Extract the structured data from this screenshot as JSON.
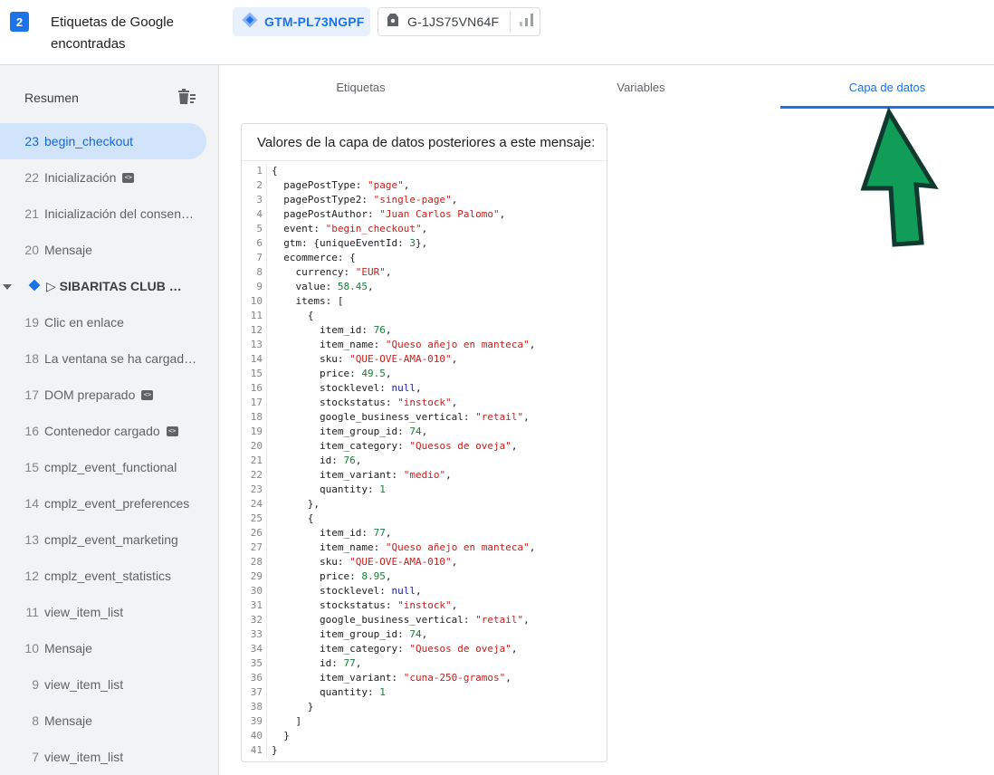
{
  "header": {
    "count_badge": "2",
    "title": "Etiquetas de Google encontradas",
    "gtm_container": "GTM-PL73NGPF",
    "ga_property": "G-1JS75VN64F",
    "icons": {
      "gtm": "gtm-diamond-icon",
      "ga": "ga-tag-icon",
      "analytics": "bar-chart-icon"
    }
  },
  "sidebar": {
    "title": "Resumen",
    "clear_icon": "clear-list-icon",
    "items": [
      {
        "num": "23",
        "label": "begin_checkout",
        "selected": true,
        "code_chip": false
      },
      {
        "num": "22",
        "label": "Inicialización",
        "selected": false,
        "code_chip": true
      },
      {
        "num": "21",
        "label": "Inicialización del consen…",
        "selected": false,
        "code_chip": false
      },
      {
        "num": "20",
        "label": "Mensaje",
        "selected": false,
        "code_chip": false
      },
      {
        "group": true,
        "label": "SIBARITAS CLUB",
        "prefix": "▷",
        "suffix": "◁ T…"
      },
      {
        "num": "19",
        "label": "Clic en enlace",
        "selected": false,
        "code_chip": false
      },
      {
        "num": "18",
        "label": "La ventana se ha cargad…",
        "selected": false,
        "code_chip": false
      },
      {
        "num": "17",
        "label": "DOM preparado",
        "selected": false,
        "code_chip": true
      },
      {
        "num": "16",
        "label": "Contenedor cargado",
        "selected": false,
        "code_chip": true
      },
      {
        "num": "15",
        "label": "cmplz_event_functional",
        "selected": false,
        "code_chip": false
      },
      {
        "num": "14",
        "label": "cmplz_event_preferences",
        "selected": false,
        "code_chip": false
      },
      {
        "num": "13",
        "label": "cmplz_event_marketing",
        "selected": false,
        "code_chip": false
      },
      {
        "num": "12",
        "label": "cmplz_event_statistics",
        "selected": false,
        "code_chip": false
      },
      {
        "num": "11",
        "label": "view_item_list",
        "selected": false,
        "code_chip": false
      },
      {
        "num": "10",
        "label": "Mensaje",
        "selected": false,
        "code_chip": false
      },
      {
        "num": "9",
        "label": "view_item_list",
        "selected": false,
        "code_chip": false
      },
      {
        "num": "8",
        "label": "Mensaje",
        "selected": false,
        "code_chip": false
      },
      {
        "num": "7",
        "label": "view_item_list",
        "selected": false,
        "code_chip": false
      }
    ]
  },
  "tabs": [
    {
      "label": "Etiquetas",
      "active": false
    },
    {
      "label": "Variables",
      "active": false
    },
    {
      "label": "Capa de datos",
      "active": true
    }
  ],
  "datalayer_card": {
    "title": "Valores de la capa de datos posteriores a este mensaje:",
    "lines": [
      [
        [
          "p",
          "{"
        ]
      ],
      [
        [
          "k",
          "  pagePostType: "
        ],
        [
          "s",
          "\"page\""
        ],
        [
          "p",
          ","
        ]
      ],
      [
        [
          "k",
          "  pagePostType2: "
        ],
        [
          "s",
          "\"single-page\""
        ],
        [
          "p",
          ","
        ]
      ],
      [
        [
          "k",
          "  pagePostAuthor: "
        ],
        [
          "s",
          "\"Juan Carlos Palomo\""
        ],
        [
          "p",
          ","
        ]
      ],
      [
        [
          "k",
          "  event: "
        ],
        [
          "s",
          "\"begin_checkout\""
        ],
        [
          "p",
          ","
        ]
      ],
      [
        [
          "k",
          "  gtm: {uniqueEventId: "
        ],
        [
          "n",
          "3"
        ],
        [
          "p",
          "},"
        ]
      ],
      [
        [
          "k",
          "  ecommerce: {"
        ]
      ],
      [
        [
          "k",
          "    currency: "
        ],
        [
          "s",
          "\"EUR\""
        ],
        [
          "p",
          ","
        ]
      ],
      [
        [
          "k",
          "    value: "
        ],
        [
          "n",
          "58.45"
        ],
        [
          "p",
          ","
        ]
      ],
      [
        [
          "k",
          "    items: ["
        ]
      ],
      [
        [
          "p",
          "      {"
        ]
      ],
      [
        [
          "k",
          "        item_id: "
        ],
        [
          "n",
          "76"
        ],
        [
          "p",
          ","
        ]
      ],
      [
        [
          "k",
          "        item_name: "
        ],
        [
          "s",
          "\"Queso añejo en manteca\""
        ],
        [
          "p",
          ","
        ]
      ],
      [
        [
          "k",
          "        sku: "
        ],
        [
          "s",
          "\"QUE-OVE-AMA-010\""
        ],
        [
          "p",
          ","
        ]
      ],
      [
        [
          "k",
          "        price: "
        ],
        [
          "n",
          "49.5"
        ],
        [
          "p",
          ","
        ]
      ],
      [
        [
          "k",
          "        stocklevel: "
        ],
        [
          "w",
          "null"
        ],
        [
          "p",
          ","
        ]
      ],
      [
        [
          "k",
          "        stockstatus: "
        ],
        [
          "s",
          "\"instock\""
        ],
        [
          "p",
          ","
        ]
      ],
      [
        [
          "k",
          "        google_business_vertical: "
        ],
        [
          "s",
          "\"retail\""
        ],
        [
          "p",
          ","
        ]
      ],
      [
        [
          "k",
          "        item_group_id: "
        ],
        [
          "n",
          "74"
        ],
        [
          "p",
          ","
        ]
      ],
      [
        [
          "k",
          "        item_category: "
        ],
        [
          "s",
          "\"Quesos de oveja\""
        ],
        [
          "p",
          ","
        ]
      ],
      [
        [
          "k",
          "        id: "
        ],
        [
          "n",
          "76"
        ],
        [
          "p",
          ","
        ]
      ],
      [
        [
          "k",
          "        item_variant: "
        ],
        [
          "s",
          "\"medio\""
        ],
        [
          "p",
          ","
        ]
      ],
      [
        [
          "k",
          "        quantity: "
        ],
        [
          "n",
          "1"
        ]
      ],
      [
        [
          "p",
          "      },"
        ]
      ],
      [
        [
          "p",
          "      {"
        ]
      ],
      [
        [
          "k",
          "        item_id: "
        ],
        [
          "n",
          "77"
        ],
        [
          "p",
          ","
        ]
      ],
      [
        [
          "k",
          "        item_name: "
        ],
        [
          "s",
          "\"Queso añejo en manteca\""
        ],
        [
          "p",
          ","
        ]
      ],
      [
        [
          "k",
          "        sku: "
        ],
        [
          "s",
          "\"QUE-OVE-AMA-010\""
        ],
        [
          "p",
          ","
        ]
      ],
      [
        [
          "k",
          "        price: "
        ],
        [
          "n",
          "8.95"
        ],
        [
          "p",
          ","
        ]
      ],
      [
        [
          "k",
          "        stocklevel: "
        ],
        [
          "w",
          "null"
        ],
        [
          "p",
          ","
        ]
      ],
      [
        [
          "k",
          "        stockstatus: "
        ],
        [
          "s",
          "\"instock\""
        ],
        [
          "p",
          ","
        ]
      ],
      [
        [
          "k",
          "        google_business_vertical: "
        ],
        [
          "s",
          "\"retail\""
        ],
        [
          "p",
          ","
        ]
      ],
      [
        [
          "k",
          "        item_group_id: "
        ],
        [
          "n",
          "74"
        ],
        [
          "p",
          ","
        ]
      ],
      [
        [
          "k",
          "        item_category: "
        ],
        [
          "s",
          "\"Quesos de oveja\""
        ],
        [
          "p",
          ","
        ]
      ],
      [
        [
          "k",
          "        id: "
        ],
        [
          "n",
          "77"
        ],
        [
          "p",
          ","
        ]
      ],
      [
        [
          "k",
          "        item_variant: "
        ],
        [
          "s",
          "\"cuna-250-gramos\""
        ],
        [
          "p",
          ","
        ]
      ],
      [
        [
          "k",
          "        quantity: "
        ],
        [
          "n",
          "1"
        ]
      ],
      [
        [
          "p",
          "      }"
        ]
      ],
      [
        [
          "p",
          "    ]"
        ]
      ],
      [
        [
          "p",
          "  }"
        ]
      ],
      [
        [
          "p",
          "}"
        ]
      ]
    ]
  },
  "colors": {
    "accent": "#1a73e8",
    "selected_bg": "#d2e3fc",
    "sidebar_bg": "#f1f3f4",
    "string": "#c5221f",
    "number": "#188038",
    "keyword": "#1a1aa6",
    "arrow_fill": "#0f9d58",
    "arrow_stroke": "#103a2f"
  }
}
